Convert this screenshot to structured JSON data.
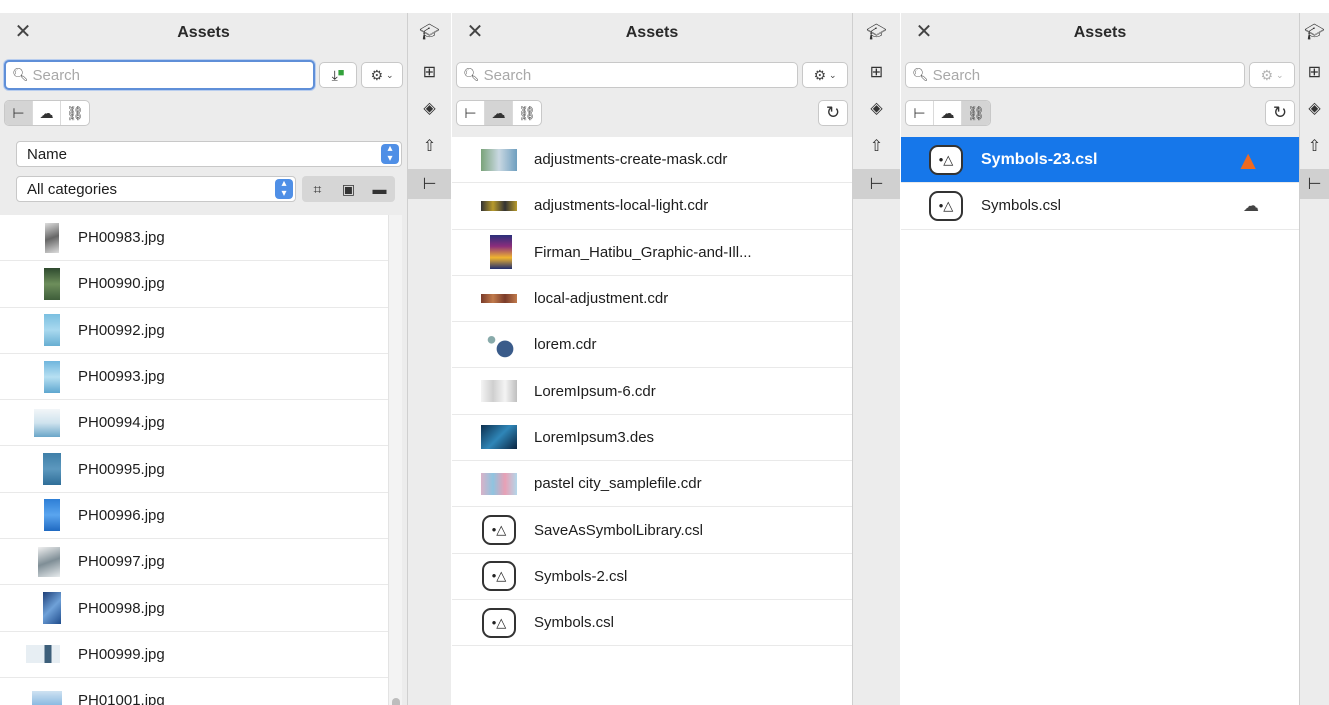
{
  "panel1": {
    "title": "Assets",
    "search_placeholder": "Search",
    "sort_value": "Name",
    "category_value": "All categories",
    "files": [
      "PH00983.jpg",
      "PH00990.jpg",
      "PH00992.jpg",
      "PH00993.jpg",
      "PH00994.jpg",
      "PH00995.jpg",
      "PH00996.jpg",
      "PH00997.jpg",
      "PH00998.jpg",
      "PH00999.jpg",
      "PH01001.jpg"
    ]
  },
  "panel2": {
    "title": "Assets",
    "search_placeholder": "Search",
    "files": [
      "adjustments-create-mask.cdr",
      "adjustments-local-light.cdr",
      "Firman_Hatibu_Graphic-and-Ill...",
      "local-adjustment.cdr",
      "lorem.cdr",
      "LoremIpsum-6.cdr",
      "LoremIpsum3.des",
      "pastel city_samplefile.cdr",
      "SaveAsSymbolLibrary.csl",
      "Symbols-2.csl",
      "Symbols.csl"
    ]
  },
  "panel3": {
    "title": "Assets",
    "search_placeholder": "Search",
    "files": [
      "Symbols-23.csl",
      "Symbols.csl"
    ]
  },
  "colors": {
    "accent": "#1677ea",
    "warning": "#ef6a22",
    "focus": "#5f8fd8"
  },
  "icons": {
    "close": "close-icon",
    "rail": [
      "learn-icon",
      "tree-view-icon",
      "layers-icon",
      "export-icon",
      "assets-icon"
    ],
    "segments": [
      "local-tree-icon",
      "cloud-icon",
      "link-icon"
    ]
  }
}
